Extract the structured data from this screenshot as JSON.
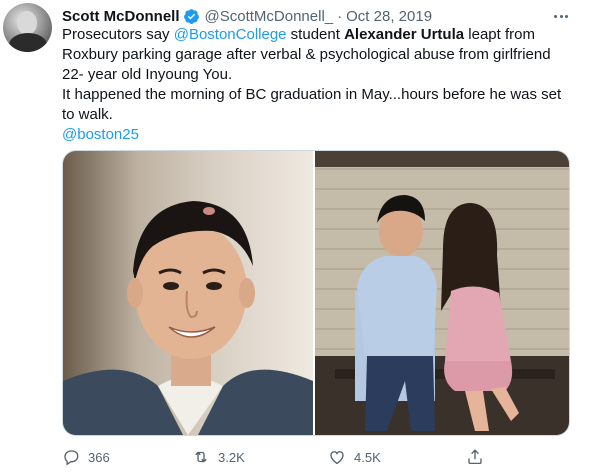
{
  "tweet": {
    "author_name": "Scott McDonnell",
    "handle": "@ScottMcDonnell_",
    "separator": "·",
    "date": "Oct 28, 2019",
    "text": {
      "l1_pre": "Prosecutors say ",
      "l1_link": "@BostonCollege",
      "l1_mid": " student ",
      "l1_bold": "Alexander Urtula",
      "l1_post": " leapt from",
      "l2": "Roxbury parking garage after verbal & psychological abuse from girlfriend",
      "l3": "22- year old Inyoung You.",
      "l4": "It happened the morning of BC graduation in May...hours before he was set",
      "l5": "to walk.",
      "l6_link": "@boston25"
    }
  },
  "actions": {
    "reply_count": "366",
    "retweet_count": "3.2K",
    "like_count": "4.5K"
  },
  "icons": {
    "verified": "verified-badge-icon",
    "more": "more-options-icon",
    "reply": "reply-icon",
    "retweet": "retweet-icon",
    "like": "heart-icon",
    "share": "share-icon"
  },
  "colors": {
    "link": "#1d9bf0",
    "secondary_text": "#536471",
    "primary_text": "#0f1419"
  }
}
